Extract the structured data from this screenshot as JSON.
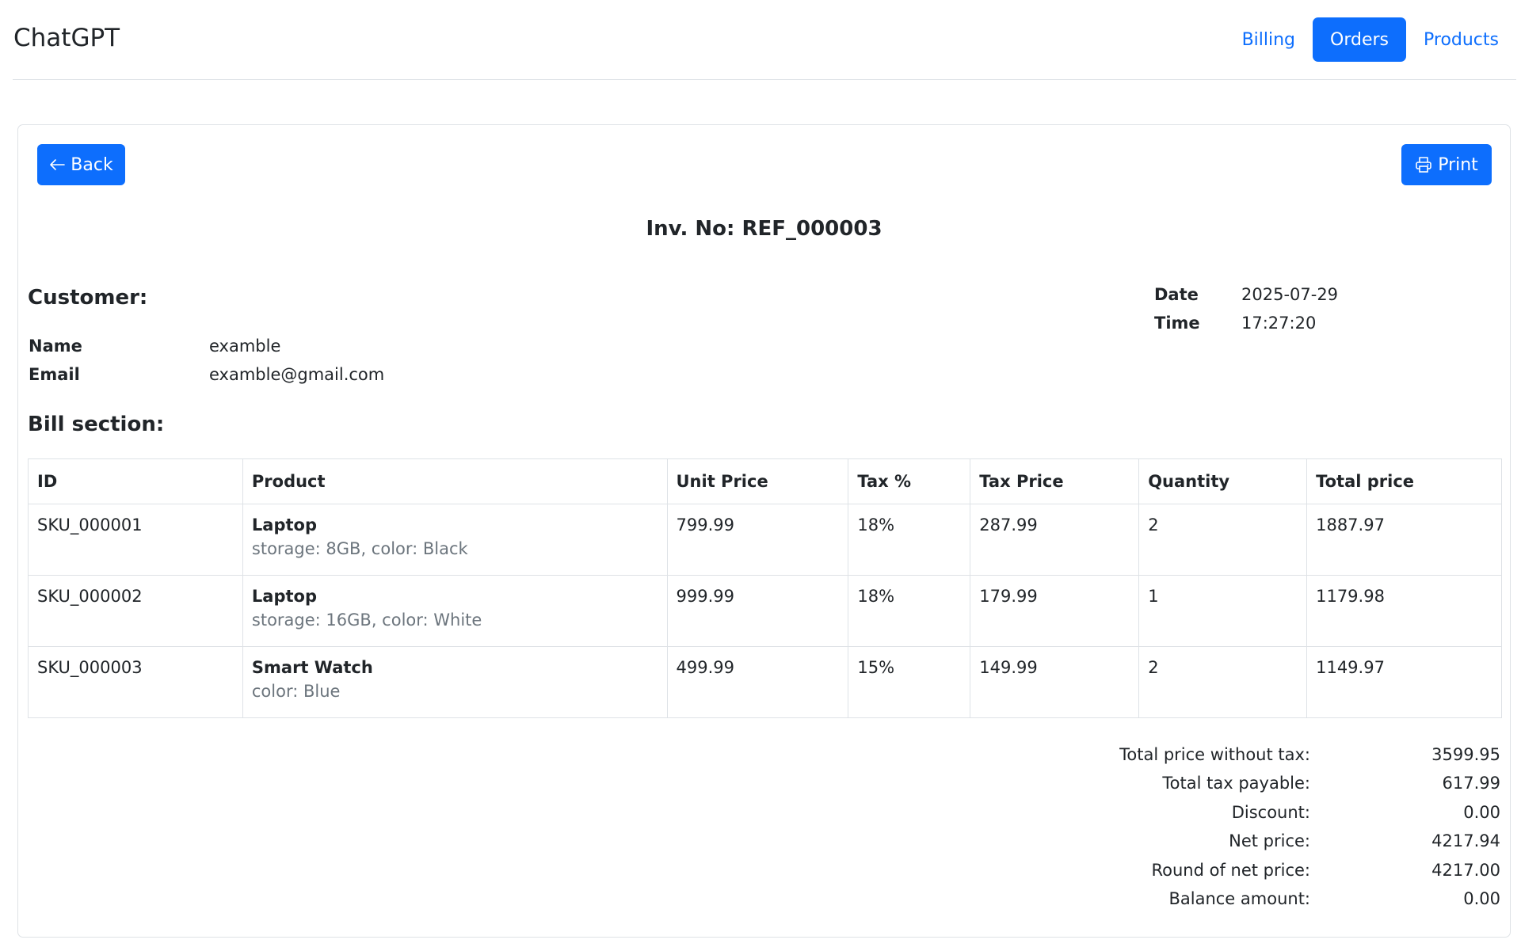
{
  "navbar": {
    "brand": "ChatGPT",
    "links": [
      {
        "label": "Billing",
        "active": false
      },
      {
        "label": "Orders",
        "active": true
      },
      {
        "label": "Products",
        "active": false
      }
    ]
  },
  "actions": {
    "back_label": "Back",
    "print_label": "Print"
  },
  "invoice": {
    "title": "Inv. No: REF_000003"
  },
  "customer": {
    "heading": "Customer:",
    "name_label": "Name",
    "name": "examble",
    "email_label": "Email",
    "email": "examble@gmail.com"
  },
  "datetime": {
    "date_label": "Date",
    "date": "2025-07-29",
    "time_label": "Time",
    "time": "17:27:20"
  },
  "bill": {
    "heading": "Bill section:",
    "columns": [
      "ID",
      "Product",
      "Unit Price",
      "Tax %",
      "Tax Price",
      "Quantity",
      "Total price"
    ],
    "rows": [
      {
        "id": "SKU_000001",
        "product": "Laptop",
        "attributes": "storage: 8GB, color: Black",
        "unit_price": "799.99",
        "tax_pct": "18%",
        "tax_price": "287.99",
        "quantity": "2",
        "total": "1887.97"
      },
      {
        "id": "SKU_000002",
        "product": "Laptop",
        "attributes": "storage: 16GB, color: White",
        "unit_price": "999.99",
        "tax_pct": "18%",
        "tax_price": "179.99",
        "quantity": "1",
        "total": "1179.98"
      },
      {
        "id": "SKU_000003",
        "product": "Smart Watch",
        "attributes": "color: Blue",
        "unit_price": "499.99",
        "tax_pct": "15%",
        "tax_price": "149.99",
        "quantity": "2",
        "total": "1149.97"
      }
    ]
  },
  "summary": [
    {
      "label": "Total price without tax:",
      "value": "3599.95"
    },
    {
      "label": "Total tax payable:",
      "value": "617.99"
    },
    {
      "label": "Discount:",
      "value": "0.00"
    },
    {
      "label": "Net price:",
      "value": "4217.94"
    },
    {
      "label": "Round of net price:",
      "value": "4217.00"
    },
    {
      "label": "Balance amount:",
      "value": "0.00"
    }
  ],
  "icons": {
    "back": "arrow-left-icon",
    "print": "printer-icon"
  },
  "colors": {
    "primary": "#0d6efd",
    "muted_text": "#6c757d",
    "border": "#dee2e6",
    "text": "#212529"
  }
}
